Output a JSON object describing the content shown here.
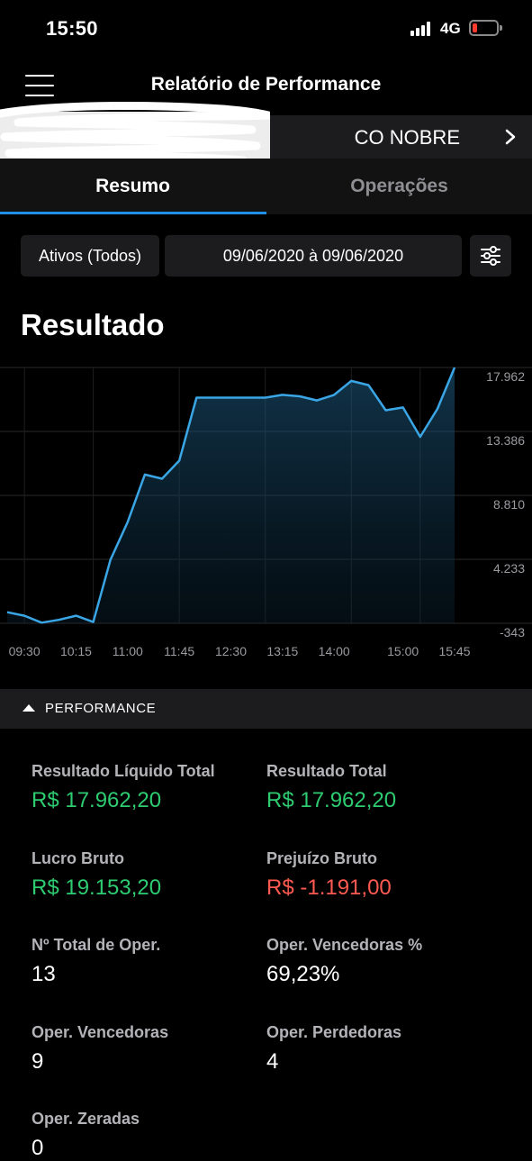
{
  "status_bar": {
    "time": "15:50",
    "network": "4G"
  },
  "header": {
    "title": "Relatório de Performance",
    "menu_icon": "hamburger-menu-icon"
  },
  "account": {
    "name": "CO NOBRE",
    "chevron_icon": "chevron-right-icon"
  },
  "tabs": [
    {
      "label": "Resumo",
      "active": true
    },
    {
      "label": "Operações",
      "active": false
    }
  ],
  "filters": {
    "assets": "Ativos (Todos)",
    "date_range": "09/06/2020 à 09/06/2020",
    "settings_icon": "sliders-icon"
  },
  "section_title": "Resultado",
  "colors": {
    "accent": "#1e90e6",
    "line": "#3aa6e6",
    "positive": "#2ecc71",
    "negative": "#ff5a52"
  },
  "chart_data": {
    "type": "area",
    "x_tick_labels": [
      "09:30",
      "10:15",
      "11:00",
      "11:45",
      "12:30",
      "13:15",
      "14:00",
      "15:00",
      "15:45"
    ],
    "y_tick_labels": [
      "17.962",
      "13.386",
      "8.810",
      "4.233",
      "-343"
    ],
    "ylim": [
      -343,
      17962
    ],
    "grid": true,
    "series": [
      {
        "x": [
          "09:15",
          "09:30",
          "09:45",
          "10:00",
          "10:15",
          "10:30",
          "10:45",
          "11:00",
          "11:15",
          "11:30",
          "11:45",
          "12:00",
          "12:15",
          "12:30",
          "12:45",
          "13:00",
          "13:15",
          "13:30",
          "13:45",
          "14:00",
          "14:15",
          "14:30",
          "14:45",
          "15:00",
          "15:15",
          "15:30",
          "15:45"
        ],
        "y": [
          450,
          200,
          -300,
          -100,
          200,
          -250,
          4200,
          6900,
          10300,
          10000,
          11300,
          15800,
          15800,
          15800,
          15800,
          15800,
          16000,
          15900,
          15600,
          16000,
          17000,
          16700,
          14900,
          15100,
          13000,
          15000,
          17962
        ]
      }
    ]
  },
  "performance": {
    "label": "PERFORMANCE",
    "metrics": [
      {
        "label": "Resultado Líquido Total",
        "value": "R$ 17.962,20",
        "tone": "green"
      },
      {
        "label": "Resultado Total",
        "value": "R$ 17.962,20",
        "tone": "green"
      },
      {
        "label": "Lucro Bruto",
        "value": "R$ 19.153,20",
        "tone": "green"
      },
      {
        "label": "Prejuízo Bruto",
        "value": "R$ -1.191,00",
        "tone": "red"
      },
      {
        "label": "Nº Total de Oper.",
        "value": "13",
        "tone": "white"
      },
      {
        "label": "Oper. Vencedoras %",
        "value": "69,23%",
        "tone": "white"
      },
      {
        "label": "Oper. Vencedoras",
        "value": "9",
        "tone": "white"
      },
      {
        "label": "Oper. Perdedoras",
        "value": "4",
        "tone": "white"
      },
      {
        "label": "Oper. Zeradas",
        "value": "0",
        "tone": "white"
      }
    ]
  }
}
